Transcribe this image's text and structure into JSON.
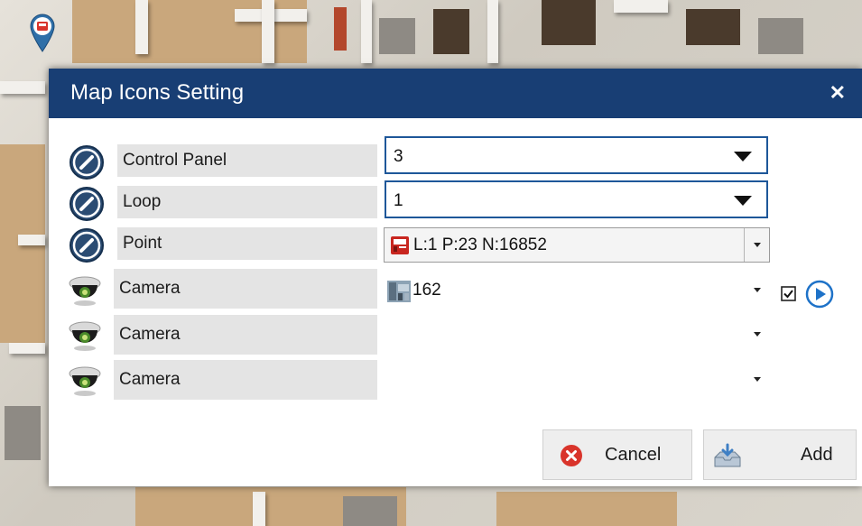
{
  "dialog": {
    "title": "Map Icons Setting",
    "close_label": "✕"
  },
  "rows": [
    {
      "label": "Control Panel",
      "value": "3",
      "icon": "pencil-icon"
    },
    {
      "label": "Loop",
      "value": "1",
      "icon": "pencil-icon"
    },
    {
      "label": "Point",
      "value": "L:1 P:23 N:16852",
      "icon": "pencil-icon",
      "value_icon": "fire-panel-icon"
    },
    {
      "label": "Camera",
      "value": "162",
      "icon": "dome-camera-icon",
      "value_icon": "camera-thumbnail-icon",
      "checked": true
    },
    {
      "label": "Camera",
      "value": "",
      "icon": "dome-camera-icon"
    },
    {
      "label": "Camera",
      "value": "",
      "icon": "dome-camera-icon"
    }
  ],
  "buttons": {
    "cancel_label": "Cancel",
    "add_label": "Add"
  },
  "colors": {
    "titlebar": "#183e74",
    "accent_border": "#1e5799",
    "cancel_icon": "#d9342b",
    "play_icon": "#1e72c8"
  }
}
